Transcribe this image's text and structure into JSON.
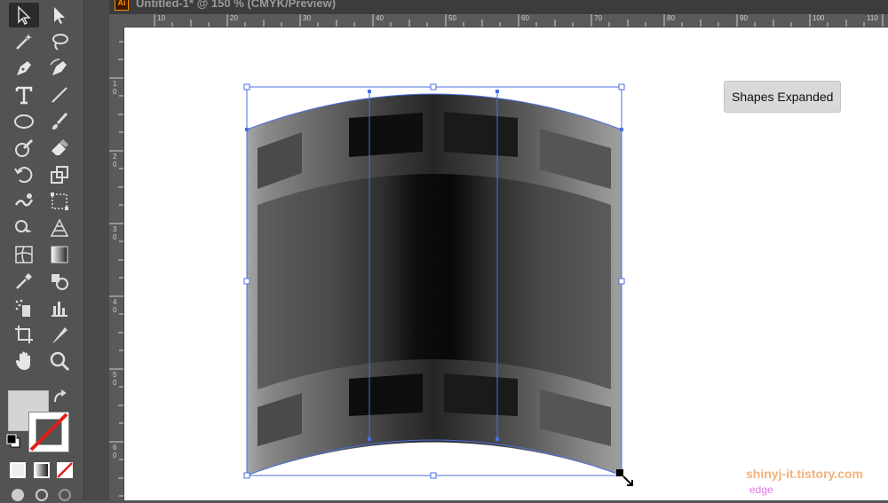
{
  "document": {
    "app_badge": "Ai",
    "title": "Untitled-1* @ 150 % (CMYK/Preview)"
  },
  "ruler": {
    "horizontal": [
      "10",
      "20",
      "30",
      "40",
      "50",
      "60",
      "70",
      "80",
      "90",
      "100",
      "110"
    ],
    "vertical": [
      "1\n0",
      "2\n0",
      "3\n0",
      "4\n0",
      "5\n0",
      "6\n0"
    ]
  },
  "tooltip": "Shapes Expanded",
  "smart_guide_label": "edge",
  "watermark": "shinyj-it.tistory.com",
  "colors": {
    "panel": "#535353",
    "selection": "#4b6fe0",
    "fill_swatch": "#d4d4d4",
    "stroke_none": "#e0201b",
    "guide_label": "#e07be0",
    "watermark": "#f1b27a"
  },
  "tools": [
    "selection-tool",
    "direct-selection-tool",
    "magic-wand-tool",
    "lasso-tool",
    "pen-tool",
    "curvature-tool",
    "type-tool",
    "line-segment-tool",
    "ellipse-tool",
    "paintbrush-tool",
    "shaper-tool",
    "eraser-tool",
    "rotate-tool",
    "scale-tool",
    "warp-tool",
    "free-transform-tool",
    "shape-builder-tool",
    "perspective-grid-tool",
    "mesh-tool",
    "gradient-tool",
    "eyedropper-tool",
    "blend-tool",
    "symbol-sprayer-tool",
    "column-graph-tool",
    "artboard-tool",
    "slice-tool",
    "hand-tool",
    "zoom-tool"
  ]
}
